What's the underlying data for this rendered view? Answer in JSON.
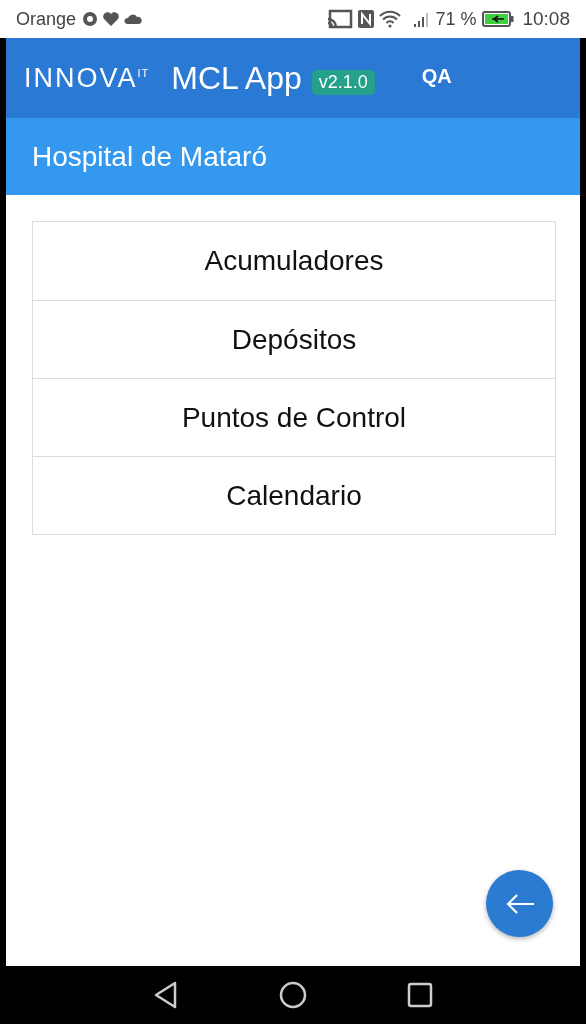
{
  "status_bar": {
    "carrier": "Orange",
    "battery": "71 %",
    "time": "10:08"
  },
  "app_bar": {
    "logo": "INNOVA",
    "logo_sup": "IT",
    "title": "MCL App",
    "version": "v2.1.0",
    "environment": "QA"
  },
  "subheader": {
    "title": "Hospital de Mataró"
  },
  "menu": [
    {
      "label": "Acumuladores"
    },
    {
      "label": "Depósitos"
    },
    {
      "label": "Puntos de Control"
    },
    {
      "label": "Calendario"
    }
  ]
}
